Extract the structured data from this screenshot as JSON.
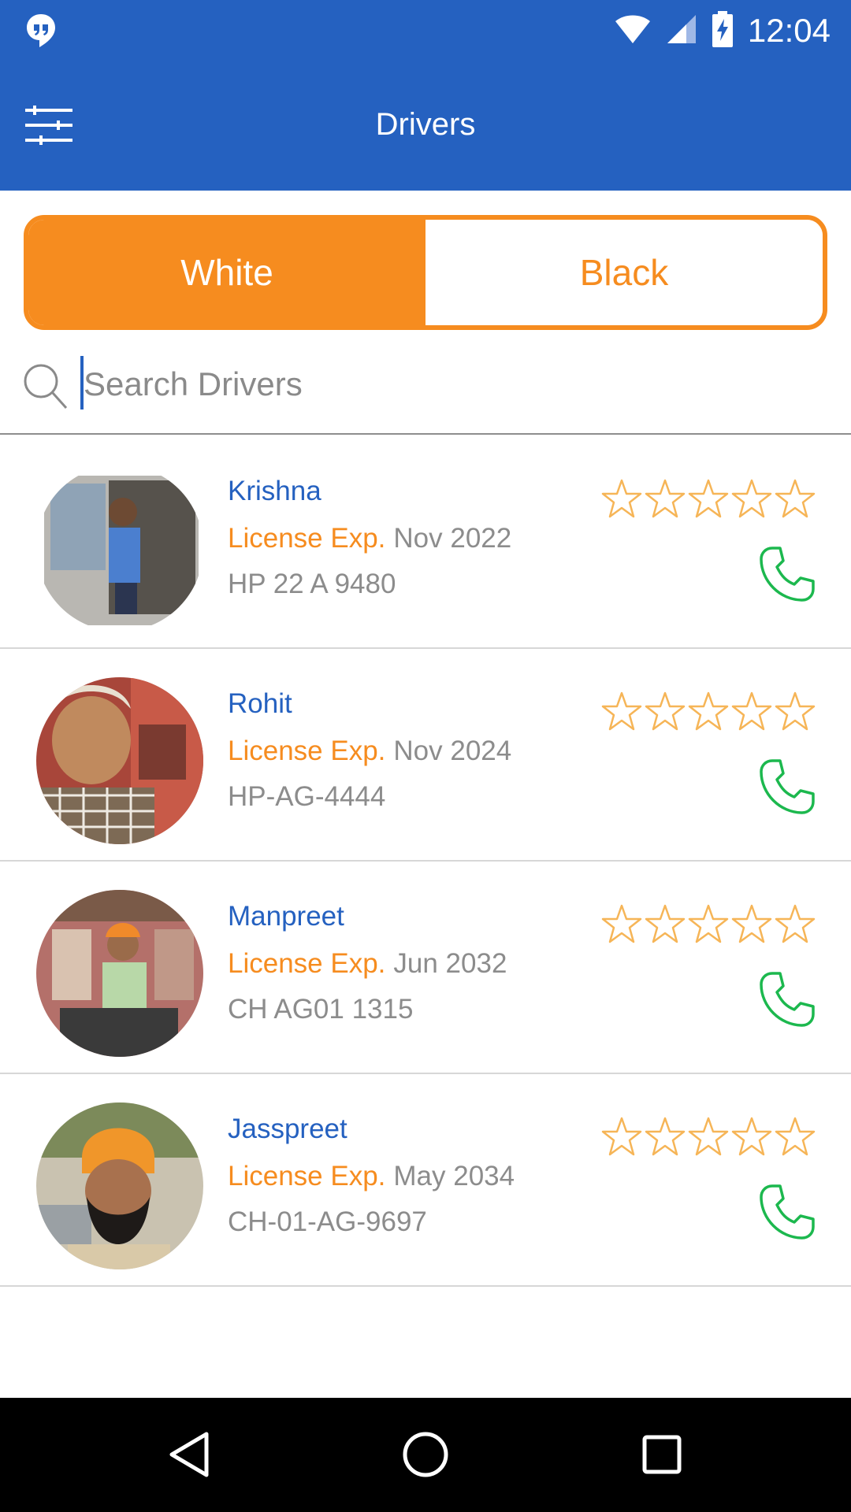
{
  "status_bar": {
    "time": "12:04",
    "icons": [
      "hangouts-icon",
      "wifi-icon",
      "signal-icon",
      "battery-charging-icon"
    ]
  },
  "app_bar": {
    "title": "Drivers",
    "menu_icon": "sliders-icon"
  },
  "toggle": {
    "options": [
      {
        "label": "White",
        "selected": true
      },
      {
        "label": "Black",
        "selected": false
      }
    ]
  },
  "search": {
    "placeholder": "Search Drivers",
    "value": "",
    "icon": "search-icon"
  },
  "drivers": [
    {
      "name": "Krishna",
      "license_label": "License Exp.",
      "license_exp": "Nov 2022",
      "plate": "HP 22 A 9480",
      "rating": 0
    },
    {
      "name": "Rohit",
      "license_label": "License Exp.",
      "license_exp": "Nov 2024",
      "plate": "HP-AG-4444",
      "rating": 0
    },
    {
      "name": "Manpreet",
      "license_label": "License Exp.",
      "license_exp": "Jun 2032",
      "plate": "CH AG01 1315",
      "rating": 0
    },
    {
      "name": "Jasspreet",
      "license_label": "License Exp.",
      "license_exp": "May 2034",
      "plate": "CH-01-AG-9697",
      "rating": 0
    }
  ],
  "nav_bar": {
    "buttons": [
      "back-icon",
      "home-icon",
      "recents-icon"
    ]
  },
  "colors": {
    "primary": "#2561c0",
    "accent": "#f68c1f",
    "phone": "#1cb84e",
    "muted_text": "#8c8c8c"
  }
}
